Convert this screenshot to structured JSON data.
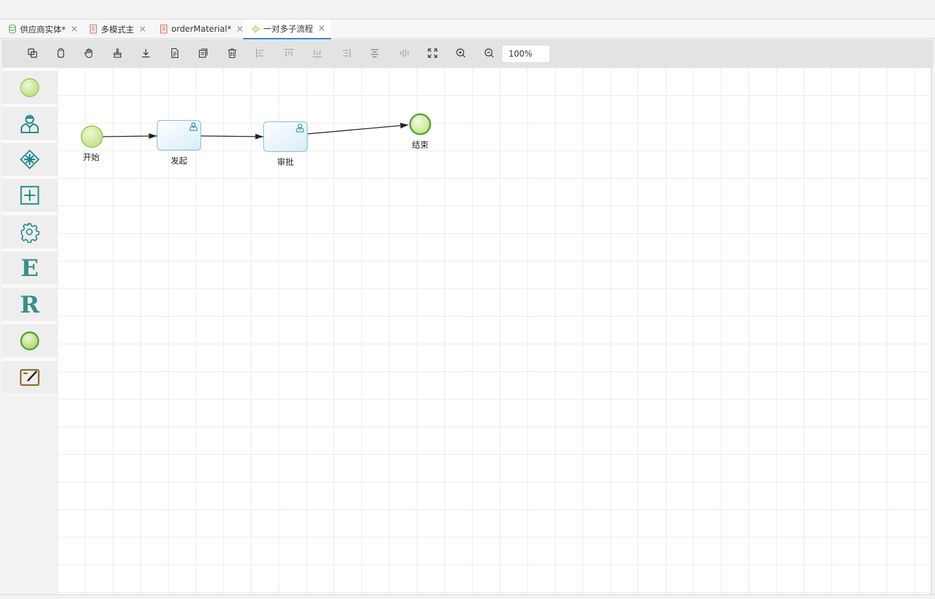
{
  "tabs": [
    {
      "label": "供应商实体*",
      "icon": "database-icon",
      "active": false
    },
    {
      "label": "多模式主",
      "icon": "document-icon",
      "active": false
    },
    {
      "label": "orderMaterial*",
      "icon": "document-icon",
      "active": false
    },
    {
      "label": "一对多子流程",
      "icon": "process-icon",
      "active": true
    }
  ],
  "toolbar": {
    "buttons": [
      "copy-icon",
      "paste-icon",
      "hand-icon",
      "clear-icon",
      "download-icon",
      "file-icon",
      "duplicate-icon",
      "delete-icon",
      "align-left-icon",
      "align-top-icon",
      "align-bottom-icon",
      "align-right-icon",
      "align-center-icon",
      "align-middle-icon",
      "fullscreen-icon",
      "zoom-in-icon",
      "zoom-out-icon"
    ],
    "zoom": "100%"
  },
  "palette": [
    "start-event-icon",
    "user-task-icon",
    "parallel-gateway-icon",
    "subprocess-icon",
    "service-task-icon",
    "e-icon",
    "r-icon",
    "end-event-icon",
    "script-task-icon"
  ],
  "diagram": {
    "nodes": [
      {
        "id": "start",
        "label": "开始",
        "type": "start-event"
      },
      {
        "id": "initiate",
        "label": "发起",
        "type": "user-task"
      },
      {
        "id": "approve",
        "label": "审批",
        "type": "user-task"
      },
      {
        "id": "end",
        "label": "结束",
        "type": "end-event"
      }
    ]
  },
  "colors": {
    "accent": "#3d7fd1",
    "event_fill": "#d9ef9e",
    "event_stroke": "#8bbd4f",
    "task_fill": "#e6f4fb",
    "task_stroke": "#7fbfcf",
    "icon_teal": "#1c8a88",
    "icon_brown": "#8a6a2a"
  }
}
